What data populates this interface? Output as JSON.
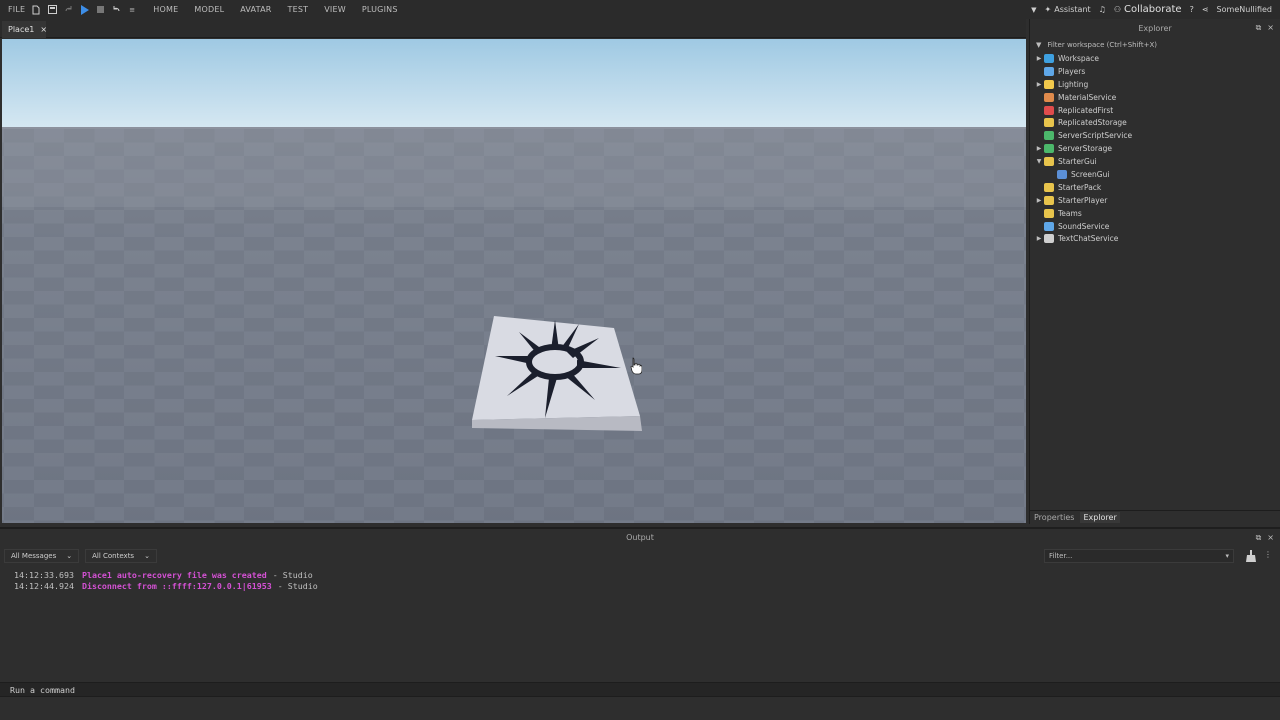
{
  "menubar": {
    "file": "FILE",
    "tabs": [
      "HOME",
      "MODEL",
      "AVATAR",
      "TEST",
      "VIEW",
      "PLUGINS"
    ],
    "assistant": "Assistant",
    "collaborate": "Collaborate",
    "user": "SomeNullified"
  },
  "document_tab": {
    "label": "Place1",
    "close": "×"
  },
  "explorer": {
    "title": "Explorer",
    "filter_placeholder": "Filter workspace (Ctrl+Shift+X)",
    "items": [
      {
        "label": "Workspace",
        "icon": "globe-icon",
        "expandable": true,
        "color": "#3ea0e0"
      },
      {
        "label": "Players",
        "icon": "players-icon",
        "expandable": false,
        "color": "#5fa7e8"
      },
      {
        "label": "Lighting",
        "icon": "lightbulb-icon",
        "expandable": true,
        "color": "#f2c94c"
      },
      {
        "label": "MaterialService",
        "icon": "material-icon",
        "expandable": false,
        "color": "#e08b4c"
      },
      {
        "label": "ReplicatedFirst",
        "icon": "replicated-first-icon",
        "expandable": false,
        "color": "#e04c4c"
      },
      {
        "label": "ReplicatedStorage",
        "icon": "replicated-storage-icon",
        "expandable": false,
        "color": "#e8c44c"
      },
      {
        "label": "ServerScriptService",
        "icon": "server-script-icon",
        "expandable": false,
        "color": "#4cb86b"
      },
      {
        "label": "ServerStorage",
        "icon": "server-storage-icon",
        "expandable": true,
        "color": "#4cb86b"
      },
      {
        "label": "StarterGui",
        "icon": "folder-icon",
        "expandable": true,
        "expanded": true,
        "color": "#e8c44c"
      },
      {
        "label": "ScreenGui",
        "icon": "screengui-icon",
        "expandable": false,
        "child": true,
        "color": "#5b8fd6"
      },
      {
        "label": "StarterPack",
        "icon": "folder-icon",
        "expandable": false,
        "color": "#e8c44c"
      },
      {
        "label": "StarterPlayer",
        "icon": "folder-icon",
        "expandable": true,
        "color": "#e8c44c"
      },
      {
        "label": "Teams",
        "icon": "folder-icon",
        "expandable": false,
        "color": "#e8c44c"
      },
      {
        "label": "SoundService",
        "icon": "sound-icon",
        "expandable": false,
        "color": "#5fa7e8"
      },
      {
        "label": "TextChatService",
        "icon": "chat-icon",
        "expandable": true,
        "color": "#cfcfcf"
      }
    ],
    "bottom_tabs": [
      "Properties",
      "Explorer"
    ]
  },
  "output": {
    "title": "Output",
    "message_filter": "All Messages",
    "context_filter": "All Contexts",
    "filter_placeholder": "Filter...",
    "lines": [
      {
        "time": "14:12:33.693",
        "message": "Place1 auto-recovery file was created",
        "source": "-  Studio"
      },
      {
        "time": "14:12:44.924",
        "message": "Disconnect from ::ffff:127.0.0.1|61953",
        "source": "-  Studio"
      }
    ]
  },
  "command_bar": {
    "placeholder": "Run a command"
  }
}
